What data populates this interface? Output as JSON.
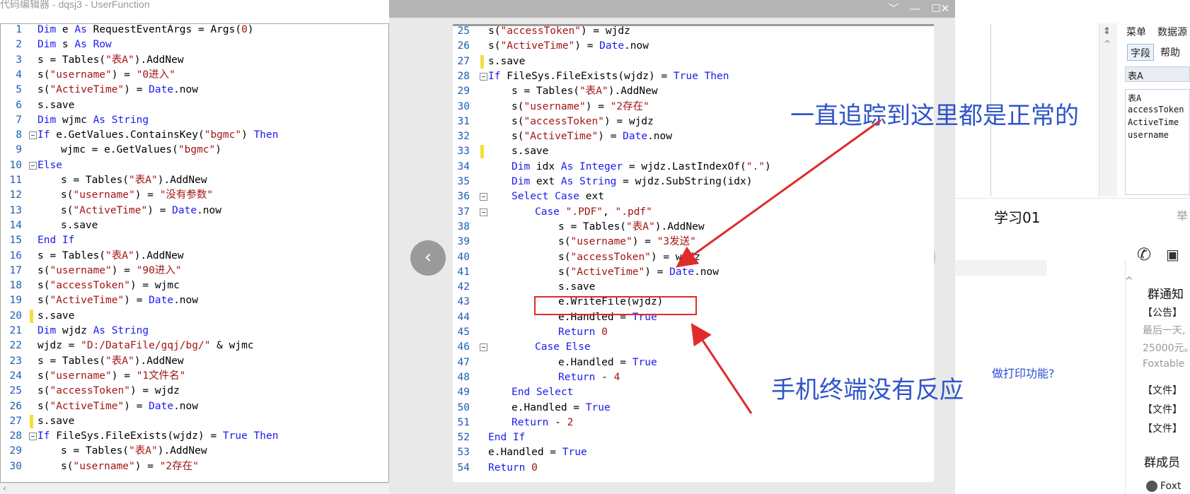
{
  "background_window": {
    "title": "代码编辑器 - dqsj3 - UserFunction",
    "lines": [
      {
        "n": "1",
        "indent": 0,
        "fold": "",
        "tokens": [
          [
            "kw",
            "Dim "
          ],
          [
            "tx",
            "e "
          ],
          [
            "kw",
            "As "
          ],
          [
            "tx",
            "RequestEventArgs = Args("
          ],
          [
            "st",
            "0"
          ],
          [
            "tx",
            ")"
          ]
        ]
      },
      {
        "n": "2",
        "indent": 0,
        "fold": "",
        "tokens": [
          [
            "kw",
            "Dim "
          ],
          [
            "tx",
            "s "
          ],
          [
            "kw",
            "As Row"
          ]
        ]
      },
      {
        "n": "3",
        "indent": 0,
        "fold": "",
        "tokens": [
          [
            "tx",
            "s = Tables("
          ],
          [
            "st",
            "\"表A\""
          ],
          [
            "tx",
            ").AddNew"
          ]
        ]
      },
      {
        "n": "4",
        "indent": 0,
        "fold": "",
        "tokens": [
          [
            "tx",
            "s("
          ],
          [
            "st",
            "\"username\""
          ],
          [
            "tx",
            ") = "
          ],
          [
            "st",
            "\"0进入\""
          ]
        ]
      },
      {
        "n": "5",
        "indent": 0,
        "fold": "",
        "tokens": [
          [
            "tx",
            "s("
          ],
          [
            "st",
            "\"ActiveTime\""
          ],
          [
            "tx",
            ") = "
          ],
          [
            "kw",
            "Date"
          ],
          [
            "tx",
            ".now"
          ]
        ]
      },
      {
        "n": "6",
        "indent": 0,
        "fold": "",
        "tokens": [
          [
            "tx",
            "s.save"
          ]
        ]
      },
      {
        "n": "7",
        "indent": 0,
        "fold": "",
        "tokens": [
          [
            "kw",
            "Dim "
          ],
          [
            "tx",
            "wjmc "
          ],
          [
            "kw",
            "As String"
          ]
        ]
      },
      {
        "n": "8",
        "indent": 0,
        "fold": "box",
        "tokens": [
          [
            "kw",
            "If "
          ],
          [
            "tx",
            "e.GetValues.ContainsKey("
          ],
          [
            "st",
            "\"bgmc\""
          ],
          [
            "tx",
            ") "
          ],
          [
            "kw",
            "Then"
          ]
        ]
      },
      {
        "n": "9",
        "indent": 1,
        "fold": "",
        "tokens": [
          [
            "tx",
            "wjmc = e.GetValues("
          ],
          [
            "st",
            "\"bgmc\""
          ],
          [
            "tx",
            ")"
          ]
        ]
      },
      {
        "n": "10",
        "indent": 0,
        "fold": "box",
        "tokens": [
          [
            "kw",
            "Else"
          ]
        ]
      },
      {
        "n": "11",
        "indent": 1,
        "fold": "",
        "tokens": [
          [
            "tx",
            "s = Tables("
          ],
          [
            "st",
            "\"表A\""
          ],
          [
            "tx",
            ").AddNew"
          ]
        ]
      },
      {
        "n": "12",
        "indent": 1,
        "fold": "",
        "tokens": [
          [
            "tx",
            "s("
          ],
          [
            "st",
            "\"username\""
          ],
          [
            "tx",
            ") = "
          ],
          [
            "st",
            "\"没有参数\""
          ]
        ]
      },
      {
        "n": "13",
        "indent": 1,
        "fold": "",
        "tokens": [
          [
            "tx",
            "s("
          ],
          [
            "st",
            "\"ActiveTime\""
          ],
          [
            "tx",
            ") = "
          ],
          [
            "kw",
            "Date"
          ],
          [
            "tx",
            ".now"
          ]
        ]
      },
      {
        "n": "14",
        "indent": 1,
        "fold": "",
        "tokens": [
          [
            "tx",
            "s.save"
          ]
        ]
      },
      {
        "n": "15",
        "indent": 0,
        "fold": "end",
        "tokens": [
          [
            "kw",
            "End If"
          ]
        ]
      },
      {
        "n": "16",
        "indent": 0,
        "fold": "",
        "tokens": [
          [
            "tx",
            "s = Tables("
          ],
          [
            "st",
            "\"表A\""
          ],
          [
            "tx",
            ").AddNew"
          ]
        ]
      },
      {
        "n": "17",
        "indent": 0,
        "fold": "",
        "tokens": [
          [
            "tx",
            "s("
          ],
          [
            "st",
            "\"username\""
          ],
          [
            "tx",
            ") = "
          ],
          [
            "st",
            "\"90进入\""
          ]
        ]
      },
      {
        "n": "18",
        "indent": 0,
        "fold": "",
        "tokens": [
          [
            "tx",
            "s("
          ],
          [
            "st",
            "\"accessToken\""
          ],
          [
            "tx",
            ") = wjmc"
          ]
        ]
      },
      {
        "n": "19",
        "indent": 0,
        "fold": "",
        "tokens": [
          [
            "tx",
            "s("
          ],
          [
            "st",
            "\"ActiveTime\""
          ],
          [
            "tx",
            ") = "
          ],
          [
            "kw",
            "Date"
          ],
          [
            "tx",
            ".now"
          ]
        ]
      },
      {
        "n": "20",
        "indent": 0,
        "fold": "chg",
        "tokens": [
          [
            "tx",
            "s.save"
          ]
        ]
      },
      {
        "n": "21",
        "indent": 0,
        "fold": "",
        "tokens": [
          [
            "kw",
            "Dim "
          ],
          [
            "tx",
            "wjdz "
          ],
          [
            "kw",
            "As String"
          ]
        ]
      },
      {
        "n": "22",
        "indent": 0,
        "fold": "",
        "tokens": [
          [
            "tx",
            "wjdz = "
          ],
          [
            "st",
            "\"D:/DataFile/gqj/bg/\""
          ],
          [
            "tx",
            " & wjmc"
          ]
        ]
      },
      {
        "n": "23",
        "indent": 0,
        "fold": "",
        "tokens": [
          [
            "tx",
            "s = Tables("
          ],
          [
            "st",
            "\"表A\""
          ],
          [
            "tx",
            ").AddNew"
          ]
        ]
      },
      {
        "n": "24",
        "indent": 0,
        "fold": "",
        "tokens": [
          [
            "tx",
            "s("
          ],
          [
            "st",
            "\"username\""
          ],
          [
            "tx",
            ") = "
          ],
          [
            "st",
            "\"1文件名\""
          ]
        ]
      },
      {
        "n": "25",
        "indent": 0,
        "fold": "",
        "tokens": [
          [
            "tx",
            "s("
          ],
          [
            "st",
            "\"accessToken\""
          ],
          [
            "tx",
            ") = wjdz"
          ]
        ]
      },
      {
        "n": "26",
        "indent": 0,
        "fold": "",
        "tokens": [
          [
            "tx",
            "s("
          ],
          [
            "st",
            "\"ActiveTime\""
          ],
          [
            "tx",
            ") = "
          ],
          [
            "kw",
            "Date"
          ],
          [
            "tx",
            ".now"
          ]
        ]
      },
      {
        "n": "27",
        "indent": 0,
        "fold": "chg",
        "tokens": [
          [
            "tx",
            "s.save"
          ]
        ]
      },
      {
        "n": "28",
        "indent": 0,
        "fold": "box",
        "tokens": [
          [
            "kw",
            "If "
          ],
          [
            "tx",
            "FileSys.FileExists(wjdz) = "
          ],
          [
            "kw",
            "True Then"
          ]
        ]
      },
      {
        "n": "29",
        "indent": 1,
        "fold": "",
        "tokens": [
          [
            "tx",
            "s = Tables("
          ],
          [
            "st",
            "\"表A\""
          ],
          [
            "tx",
            ").AddNew"
          ]
        ]
      },
      {
        "n": "30",
        "indent": 1,
        "fold": "",
        "tokens": [
          [
            "tx",
            "s("
          ],
          [
            "st",
            "\"username\""
          ],
          [
            "tx",
            ") = "
          ],
          [
            "st",
            "\"2存在\""
          ]
        ]
      }
    ]
  },
  "right_panel": {
    "menu_label": "菜单",
    "datasource_label": "数据源",
    "tab_field": "字段",
    "tab_help": "帮助",
    "table_header": "表A",
    "list_title": "表A",
    "fields": [
      "accessToken",
      "ActiveTime",
      "username"
    ]
  },
  "chat_panel": {
    "group_name": "学习01",
    "header_right": "举",
    "notice_title": "群通知",
    "notice_tag": "【公告】",
    "notice_line1": "最后一天,",
    "notice_line2": "25000元。",
    "notice_line3": "Foxtable",
    "message_snippet": "做打印功能?",
    "file1": "【文件】",
    "file2": "【文件】",
    "file3": "【文件】",
    "members_title": "群成员",
    "member1": "Foxt"
  },
  "viewer": {
    "controls": {
      "collapse": "﹀",
      "minimize": "—",
      "maximize": "☐",
      "close": "✕"
    },
    "prev": "‹",
    "next": "›"
  },
  "screenshot": {
    "lines": [
      {
        "n": "25",
        "indent": 0,
        "fold": "",
        "tokens": [
          [
            "tx",
            "s("
          ],
          [
            "st",
            "\"accessToken\""
          ],
          [
            "tx",
            ") = wjdz"
          ]
        ]
      },
      {
        "n": "26",
        "indent": 0,
        "fold": "",
        "tokens": [
          [
            "tx",
            "s("
          ],
          [
            "st",
            "\"ActiveTime\""
          ],
          [
            "tx",
            ") = "
          ],
          [
            "kw",
            "Date"
          ],
          [
            "tx",
            ".now"
          ]
        ]
      },
      {
        "n": "27",
        "indent": 0,
        "fold": "chg",
        "tokens": [
          [
            "tx",
            "s.save"
          ]
        ]
      },
      {
        "n": "28",
        "indent": 0,
        "fold": "box",
        "tokens": [
          [
            "kw",
            "If "
          ],
          [
            "tx",
            "FileSys.FileExists(wjdz) = "
          ],
          [
            "kw",
            "True Then"
          ]
        ]
      },
      {
        "n": "29",
        "indent": 1,
        "fold": "",
        "tokens": [
          [
            "tx",
            "s = Tables("
          ],
          [
            "st",
            "\"表A\""
          ],
          [
            "tx",
            ").AddNew"
          ]
        ]
      },
      {
        "n": "30",
        "indent": 1,
        "fold": "",
        "tokens": [
          [
            "tx",
            "s("
          ],
          [
            "st",
            "\"username\""
          ],
          [
            "tx",
            ") = "
          ],
          [
            "st",
            "\"2存在\""
          ]
        ]
      },
      {
        "n": "31",
        "indent": 1,
        "fold": "",
        "tokens": [
          [
            "tx",
            "s("
          ],
          [
            "st",
            "\"accessToken\""
          ],
          [
            "tx",
            ") = wjdz"
          ]
        ]
      },
      {
        "n": "32",
        "indent": 1,
        "fold": "",
        "tokens": [
          [
            "tx",
            "s("
          ],
          [
            "st",
            "\"ActiveTime\""
          ],
          [
            "tx",
            ") = "
          ],
          [
            "kw",
            "Date"
          ],
          [
            "tx",
            ".now"
          ]
        ]
      },
      {
        "n": "33",
        "indent": 1,
        "fold": "chg",
        "tokens": [
          [
            "tx",
            "s.save"
          ]
        ]
      },
      {
        "n": "34",
        "indent": 1,
        "fold": "",
        "tokens": [
          [
            "kw",
            "Dim "
          ],
          [
            "tx",
            "idx "
          ],
          [
            "kw",
            "As Integer"
          ],
          [
            "tx",
            " = wjdz.LastIndexOf("
          ],
          [
            "st",
            "\".\""
          ],
          [
            "tx",
            ")"
          ]
        ]
      },
      {
        "n": "35",
        "indent": 1,
        "fold": "",
        "tokens": [
          [
            "kw",
            "Dim "
          ],
          [
            "tx",
            "ext "
          ],
          [
            "kw",
            "As String"
          ],
          [
            "tx",
            " = wjdz.SubString(idx)"
          ]
        ]
      },
      {
        "n": "36",
        "indent": 1,
        "fold": "box",
        "tokens": [
          [
            "kw",
            "Select Case "
          ],
          [
            "tx",
            "ext"
          ]
        ]
      },
      {
        "n": "37",
        "indent": 2,
        "fold": "box",
        "tokens": [
          [
            "kw",
            "Case "
          ],
          [
            "st",
            "\".PDF\""
          ],
          [
            "tx",
            ", "
          ],
          [
            "st",
            "\".pdf\""
          ]
        ]
      },
      {
        "n": "38",
        "indent": 3,
        "fold": "",
        "tokens": [
          [
            "tx",
            "s = Tables("
          ],
          [
            "st",
            "\"表A\""
          ],
          [
            "tx",
            ").AddNew"
          ]
        ]
      },
      {
        "n": "39",
        "indent": 3,
        "fold": "",
        "tokens": [
          [
            "tx",
            "s("
          ],
          [
            "st",
            "\"username\""
          ],
          [
            "tx",
            ") = "
          ],
          [
            "st",
            "\"3发送\""
          ]
        ]
      },
      {
        "n": "40",
        "indent": 3,
        "fold": "",
        "tokens": [
          [
            "tx",
            "s("
          ],
          [
            "st",
            "\"accessToken\""
          ],
          [
            "tx",
            ") = wjdz"
          ]
        ]
      },
      {
        "n": "41",
        "indent": 3,
        "fold": "",
        "tokens": [
          [
            "tx",
            "s("
          ],
          [
            "st",
            "\"ActiveTime\""
          ],
          [
            "tx",
            ") = "
          ],
          [
            "kw",
            "Date"
          ],
          [
            "tx",
            ".now"
          ]
        ]
      },
      {
        "n": "42",
        "indent": 3,
        "fold": "",
        "tokens": [
          [
            "tx",
            "s.save"
          ]
        ]
      },
      {
        "n": "43",
        "indent": 3,
        "fold": "",
        "tokens": [
          [
            "tx",
            "e.WriteFile(wjdz)"
          ]
        ]
      },
      {
        "n": "44",
        "indent": 3,
        "fold": "",
        "tokens": [
          [
            "tx",
            "e.Handled = "
          ],
          [
            "kw",
            "True"
          ]
        ]
      },
      {
        "n": "45",
        "indent": 3,
        "fold": "",
        "tokens": [
          [
            "kw",
            "Return "
          ],
          [
            "st",
            "0"
          ]
        ]
      },
      {
        "n": "46",
        "indent": 2,
        "fold": "box",
        "tokens": [
          [
            "kw",
            "Case Else"
          ]
        ]
      },
      {
        "n": "47",
        "indent": 3,
        "fold": "",
        "tokens": [
          [
            "tx",
            "e.Handled = "
          ],
          [
            "kw",
            "True"
          ]
        ]
      },
      {
        "n": "48",
        "indent": 3,
        "fold": "",
        "tokens": [
          [
            "kw",
            "Return "
          ],
          [
            "tx",
            "- "
          ],
          [
            "st",
            "4"
          ]
        ]
      },
      {
        "n": "49",
        "indent": 1,
        "fold": "end",
        "tokens": [
          [
            "kw",
            "End Select"
          ]
        ]
      },
      {
        "n": "50",
        "indent": 1,
        "fold": "",
        "tokens": [
          [
            "tx",
            "e.Handled = "
          ],
          [
            "kw",
            "True"
          ]
        ]
      },
      {
        "n": "51",
        "indent": 1,
        "fold": "",
        "tokens": [
          [
            "kw",
            "Return "
          ],
          [
            "tx",
            "- "
          ],
          [
            "st",
            "2"
          ]
        ]
      },
      {
        "n": "52",
        "indent": 0,
        "fold": "end",
        "tokens": [
          [
            "kw",
            "End If"
          ]
        ]
      },
      {
        "n": "53",
        "indent": 0,
        "fold": "",
        "tokens": [
          [
            "tx",
            "e.Handled = "
          ],
          [
            "kw",
            "True"
          ]
        ]
      },
      {
        "n": "54",
        "indent": 0,
        "fold": "",
        "tokens": [
          [
            "kw",
            "Return "
          ],
          [
            "st",
            "0"
          ]
        ]
      }
    ]
  },
  "annotations": {
    "top_note": "一直追踪到这里都是正常的",
    "bottom_note": "手机终端没有反应",
    "accent_color": "#e02b2b",
    "note_color": "#2f55c9"
  }
}
